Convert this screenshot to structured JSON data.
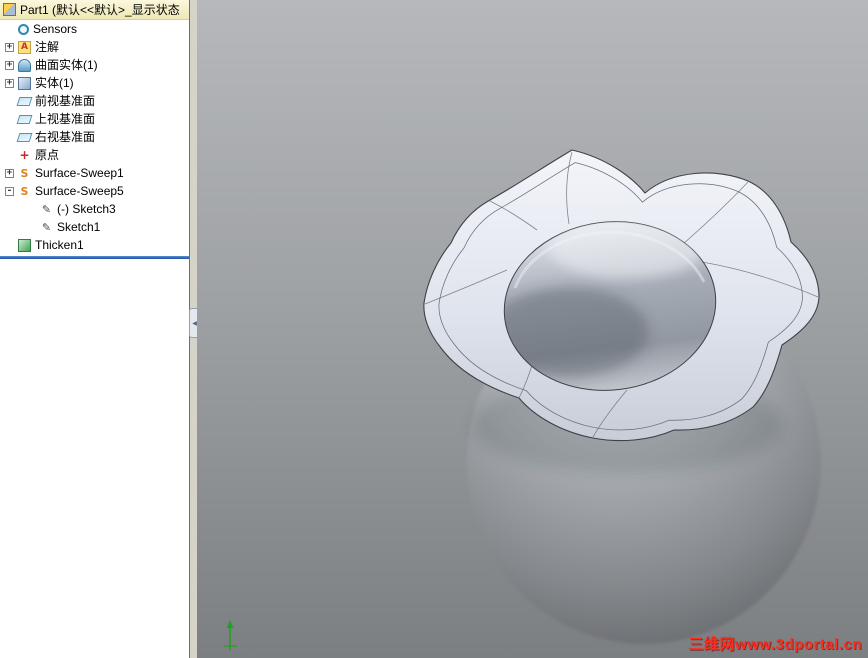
{
  "tree": {
    "header": {
      "icon": "part-icon",
      "label": "Part1 (默认<<默认>_显示状态"
    },
    "items": [
      {
        "label": "Sensors",
        "icon": "sensors-icon",
        "toggle": ""
      },
      {
        "label": "注解",
        "icon": "annotations-icon",
        "toggle": "+"
      },
      {
        "label": "曲面实体(1)",
        "icon": "surface-bodies-icon",
        "toggle": "+"
      },
      {
        "label": "实体(1)",
        "icon": "solid-bodies-icon",
        "toggle": "+"
      },
      {
        "label": "前视基准面",
        "icon": "plane-icon",
        "toggle": ""
      },
      {
        "label": "上视基准面",
        "icon": "plane-icon",
        "toggle": ""
      },
      {
        "label": "右视基准面",
        "icon": "plane-icon",
        "toggle": ""
      },
      {
        "label": "原点",
        "icon": "origin-icon",
        "toggle": ""
      },
      {
        "label": "Surface-Sweep1",
        "icon": "surface-sweep-icon",
        "toggle": "+"
      },
      {
        "label": "Surface-Sweep5",
        "icon": "surface-sweep-icon",
        "toggle": "-"
      },
      {
        "label": "(-) Sketch3",
        "icon": "sketch-icon",
        "toggle": ""
      },
      {
        "label": "Sketch1",
        "icon": "sketch-icon",
        "toggle": ""
      },
      {
        "label": "Thicken1",
        "icon": "thicken-icon",
        "toggle": ""
      }
    ]
  },
  "icons": {
    "part": "",
    "sensors": "",
    "annotations": "A",
    "surface_bodies": "",
    "solid_bodies": "",
    "plane": "",
    "origin": "+",
    "surface_sweep": "S",
    "sketch": "✎",
    "thicken": ""
  },
  "splitter": {
    "collapse_glyph": "◀"
  },
  "viewport": {
    "watermark": "三维网www.3dportal.cn",
    "model": "flower-shaped vase surface model"
  },
  "colors": {
    "viewport_top": "#b6b8bb",
    "viewport_bottom": "#7c7f82",
    "tree_header_bg": "#f2edbd",
    "rollback_blue": "#1c4fa0",
    "watermark_red": "#ff2d1e"
  }
}
